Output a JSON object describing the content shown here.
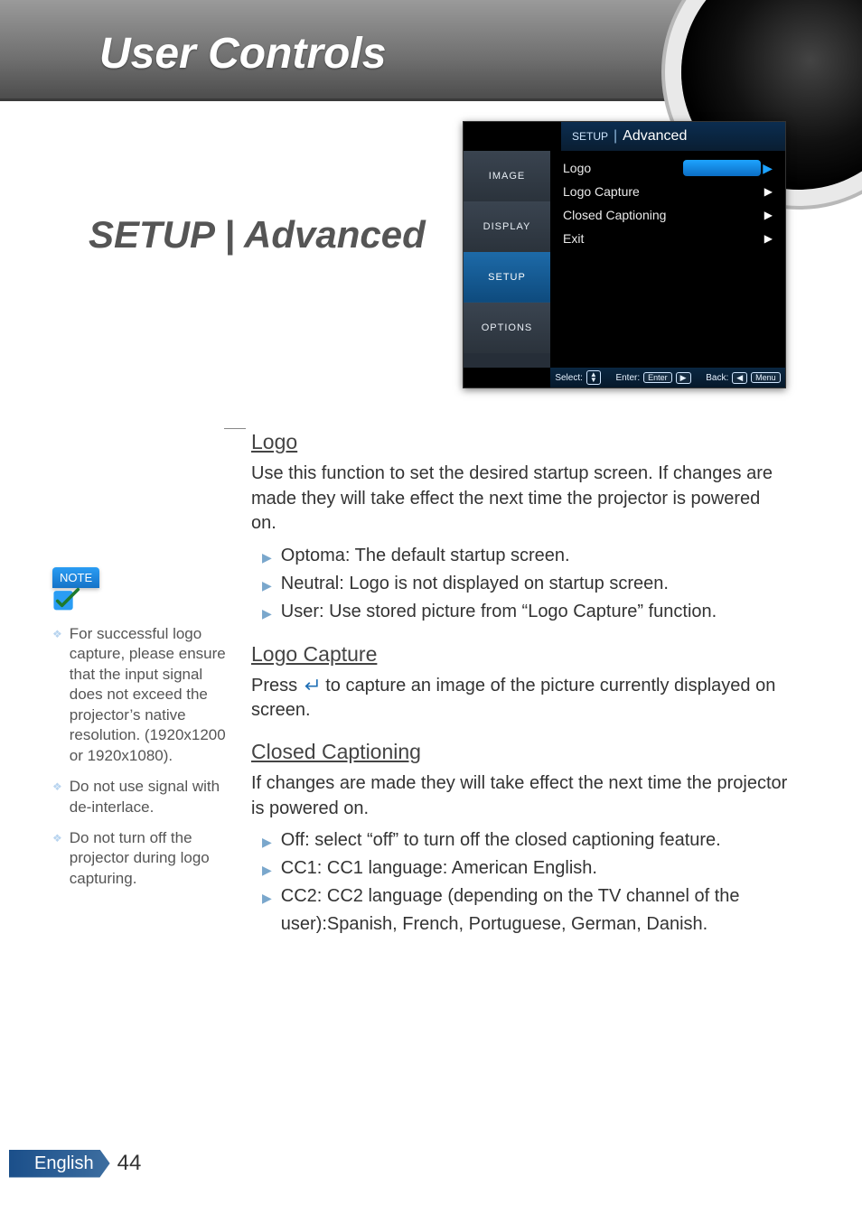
{
  "banner": {
    "title": "User Controls"
  },
  "section_title": "SETUP | Advanced",
  "osd": {
    "breadcrumb": {
      "parent": "SETUP",
      "current": "Advanced"
    },
    "tabs": [
      "IMAGE",
      "DISPLAY",
      "SETUP",
      "OPTIONS"
    ],
    "active_tab_index": 2,
    "items": [
      {
        "label": "Logo",
        "selected": true
      },
      {
        "label": "Logo Capture",
        "selected": false
      },
      {
        "label": "Closed Captioning",
        "selected": false
      },
      {
        "label": "Exit",
        "selected": false
      }
    ],
    "footer": {
      "select": "Select:",
      "enter": "Enter:",
      "enter_key": "Enter",
      "back": "Back:",
      "back_key": "Menu"
    }
  },
  "sections": {
    "logo": {
      "heading": "Logo",
      "para": "Use this function to set the desired startup screen. If changes are made they will take effect the next time the projector is powered on.",
      "bullets": [
        "Optoma: The default startup screen.",
        "Neutral: Logo is not displayed on startup screen.",
        "User: Use stored picture from “Logo Capture” function."
      ]
    },
    "logo_capture": {
      "heading": "Logo Capture",
      "para_pre": "Press ",
      "para_post": " to capture an image of the picture currently displayed on screen."
    },
    "cc": {
      "heading": "Closed Captioning",
      "para": "If changes are made they will take effect the next time the projector is powered on.",
      "bullets": [
        "Off: select “off” to turn off the closed captioning feature.",
        "CC1: CC1 language: American English.",
        "CC2: CC2 language (depending on the TV channel of the user):Spanish, French, Portuguese, German, Danish."
      ]
    }
  },
  "notes": {
    "badge": "NOTE",
    "items": [
      "For successful logo capture, please ensure that the input signal does not exceed the projector’s native resolution. (1920x1200 or 1920x1080).",
      "Do not use signal with de-interlace.",
      "Do not turn off the projector during logo capturing."
    ]
  },
  "footer": {
    "language": "English",
    "page": "44"
  }
}
